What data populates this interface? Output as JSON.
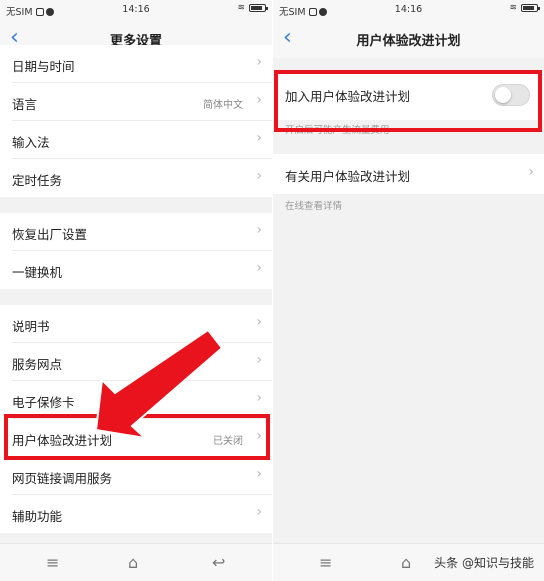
{
  "status": {
    "carrier": "无SIM",
    "time": "14:16"
  },
  "left": {
    "title": "更多设置",
    "group1": [
      {
        "label": "日期与时间",
        "value": ""
      },
      {
        "label": "语言",
        "value": "简体中文"
      },
      {
        "label": "输入法",
        "value": ""
      },
      {
        "label": "定时任务",
        "value": ""
      }
    ],
    "group2": [
      {
        "label": "恢复出厂设置",
        "value": ""
      },
      {
        "label": "一键换机",
        "value": ""
      }
    ],
    "group3": [
      {
        "label": "说明书",
        "value": ""
      },
      {
        "label": "服务网点",
        "value": ""
      },
      {
        "label": "电子保修卡",
        "value": ""
      },
      {
        "label": "用户体验改进计划",
        "value": "已关闭"
      },
      {
        "label": "网页链接调用服务",
        "value": ""
      },
      {
        "label": "辅助功能",
        "value": ""
      }
    ]
  },
  "right": {
    "title": "用户体验改进计划",
    "join_label": "加入用户体验改进计划",
    "join_enabled": false,
    "join_hint": "开启后可能产生流量费用",
    "about_label": "有关用户体验改进计划",
    "about_hint": "在线查看详情"
  },
  "watermark": "头条 @知识与技能",
  "colors": {
    "accent": "#3a7ddb",
    "highlight": "#e8131d"
  },
  "icons": [
    "back-chevron-icon",
    "menu-icon",
    "home-icon",
    "return-icon",
    "wifi-icon",
    "battery-icon"
  ]
}
